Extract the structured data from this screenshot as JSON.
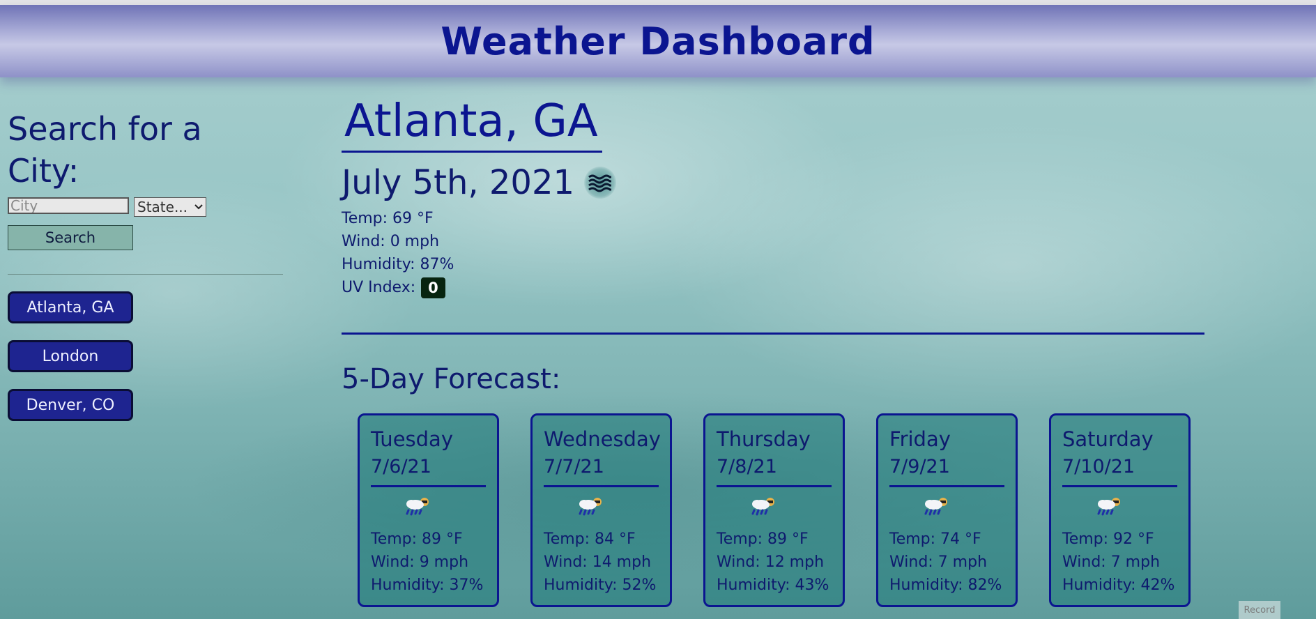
{
  "header": {
    "title": "Weather Dashboard"
  },
  "sidebar": {
    "heading": "Search for a City:",
    "city_placeholder": "City",
    "state_value": "State...",
    "search_label": "Search",
    "history": [
      "Atlanta, GA",
      "London",
      "Denver, CO"
    ]
  },
  "current": {
    "city": "Atlanta, GA",
    "date": "July 5th, 2021",
    "icon": "mist-icon",
    "temp": "Temp: 69 °F",
    "wind": "Wind: 0 mph",
    "humidity": "Humidity: 87%",
    "uv_label": "UV Index:",
    "uv_value": "0",
    "uv_color": "#07240f"
  },
  "forecast": {
    "title": "5-Day Forecast:",
    "days": [
      {
        "day": "Tuesday",
        "date": "7/6/21",
        "icon": "rain-sun-icon",
        "temp": "Temp: 89 °F",
        "wind": "Wind: 9 mph",
        "humidity": "Humidity: 37%"
      },
      {
        "day": "Wednesday",
        "date": "7/7/21",
        "icon": "rain-sun-icon",
        "temp": "Temp: 84 °F",
        "wind": "Wind: 14 mph",
        "humidity": "Humidity: 52%"
      },
      {
        "day": "Thursday",
        "date": "7/8/21",
        "icon": "rain-sun-icon",
        "temp": "Temp: 89 °F",
        "wind": "Wind: 12 mph",
        "humidity": "Humidity: 43%"
      },
      {
        "day": "Friday",
        "date": "7/9/21",
        "icon": "rain-sun-icon",
        "temp": "Temp: 74 °F",
        "wind": "Wind: 7 mph",
        "humidity": "Humidity: 82%"
      },
      {
        "day": "Saturday",
        "date": "7/10/21",
        "icon": "rain-sun-icon",
        "temp": "Temp: 92 °F",
        "wind": "Wind: 7 mph",
        "humidity": "Humidity: 42%"
      }
    ]
  },
  "overlay": {
    "record_label": "Record"
  },
  "colors": {
    "accent": "#0b1590",
    "history_button": "#1e2490",
    "card_bg": "#1e7878"
  }
}
